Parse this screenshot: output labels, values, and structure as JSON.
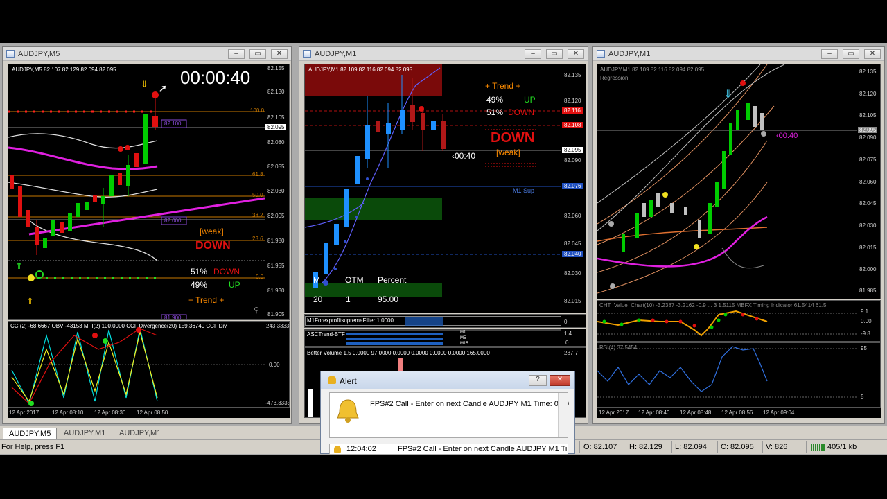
{
  "windows": [
    {
      "title": "AUDJPY,M5",
      "info": "AUDJPY,M5  82.107 82.129 82.094 82.095",
      "timer": "00:00:40",
      "prices": [
        "82.155",
        "82.130",
        "82.105",
        "82.080",
        "82.055",
        "82.030",
        "82.005",
        "81.980",
        "81.955",
        "81.930",
        "81.905"
      ],
      "price_current": "82.095",
      "fib_labels": [
        "100.0",
        "61.8",
        "50.0",
        "38.2",
        "23.6",
        "0.0"
      ],
      "box_labels": [
        "82.100",
        "82.000",
        "81.900"
      ],
      "weak": "[weak]",
      "down": "DOWN",
      "stat1_pct": "51%",
      "stat1_dir": "DOWN",
      "stat2_pct": "49%",
      "stat2_dir": "UP",
      "trend": "+  Trend  +",
      "sub_header": "CCI(2) -68.6667 OBV -43153  MFI(2) 100.0000  CCI_Divergence(20) 159.36740  CCI_Div",
      "sub_scale": [
        "243.3333",
        "0.00",
        "-473.3333"
      ],
      "times": [
        "12 Apr 2017",
        "12 Apr 08:10",
        "12 Apr 08:30",
        "12 Apr 08:50"
      ]
    },
    {
      "title": "AUDJPY,M1",
      "info": "AUDJPY,M1  82.109 82.116 82.094 82.095",
      "prices": [
        "82.135",
        "82.120",
        "82.105",
        "82.090",
        "82.075",
        "82.060",
        "82.045",
        "82.030",
        "82.015"
      ],
      "price_tags": [
        "82.116",
        "82.108",
        "82.095",
        "82.076",
        "82.040"
      ],
      "trend": "+  Trend  +",
      "stat1_pct": "49%",
      "stat1_dir": "UP",
      "stat2_pct": "51%",
      "stat2_dir": "DOWN",
      "down": "DOWN",
      "weak": "[weak]",
      "timer": "‹00:40",
      "sup": "M1 Sup",
      "table_headers": [
        "M",
        "OTM",
        "Percent"
      ],
      "table_values": [
        "20",
        "1",
        "95.00"
      ],
      "ind1": "M1ForexprofitsupremeFilter 1.0000",
      "ind1_scale": [
        "0"
      ],
      "ind2": "ASCTrend-BTF",
      "ind2_labels": [
        "M1",
        "M5",
        "M15"
      ],
      "ind2_scale": [
        "1.4",
        "0"
      ],
      "ind3": "Better Volume 1.5 0.0000 97.0000 0.0000 0.0000 0.0000 0.0000 165.0000",
      "ind3_scale": [
        "287.7"
      ]
    },
    {
      "title": "AUDJPY,M1",
      "info": "AUDJPY,M1  82.109 82.116 82.094 82.095",
      "sub_info": "Regression",
      "prices": [
        "82.135",
        "82.120",
        "82.105",
        "82.090",
        "82.075",
        "82.060",
        "82.045",
        "82.030",
        "82.015",
        "82.000",
        "81.985"
      ],
      "price_current": "82.095",
      "timer": "‹00:40",
      "sub1_header": "CHT_Value_Chart(10) -3.2387 -3.2162 -0.9 ... 3 1.5115 MBFX Timing Indicator 61.5414 61.5",
      "sub1_scale": [
        "9.1",
        "0.00",
        "-9.8"
      ],
      "sub2_header": "RSI(4) 37.5454",
      "sub2_scale": [
        "95",
        "5"
      ],
      "times": [
        "12 Apr 2017",
        "12 Apr 08:40",
        "12 Apr 08:48",
        "12 Apr 08:56",
        "12 Apr 09:04"
      ]
    }
  ],
  "tabs": [
    "AUDJPY,M5",
    "AUDJPY,M1",
    "AUDJPY,M1"
  ],
  "status": {
    "help": "For Help, press F1",
    "o": "O: 82.107",
    "h": "H: 82.129",
    "l": "L: 82.094",
    "c": "C: 82.095",
    "v": "V: 826",
    "kb": "405/1 kb"
  },
  "alert": {
    "title": "Alert",
    "message": "FPS#2 Call - Enter on next Candle AUDJPY M1 Time: 09:0",
    "list_time": "12:04:02",
    "list_msg": "FPS#2 Call - Enter on next Candle AUDJPY M1 Ti..."
  },
  "colors": {
    "bull": "#00cc00",
    "bear": "#e01010",
    "m1_bull": "#1e90ff",
    "magenta": "#e020e0",
    "orange": "#ff8c00"
  },
  "icons": [
    "chart-window-icon",
    "minimize-icon",
    "restore-icon",
    "close-icon",
    "bell-icon",
    "help-icon",
    "cursor-icon",
    "arrow-up-icon",
    "arrow-down-icon"
  ]
}
